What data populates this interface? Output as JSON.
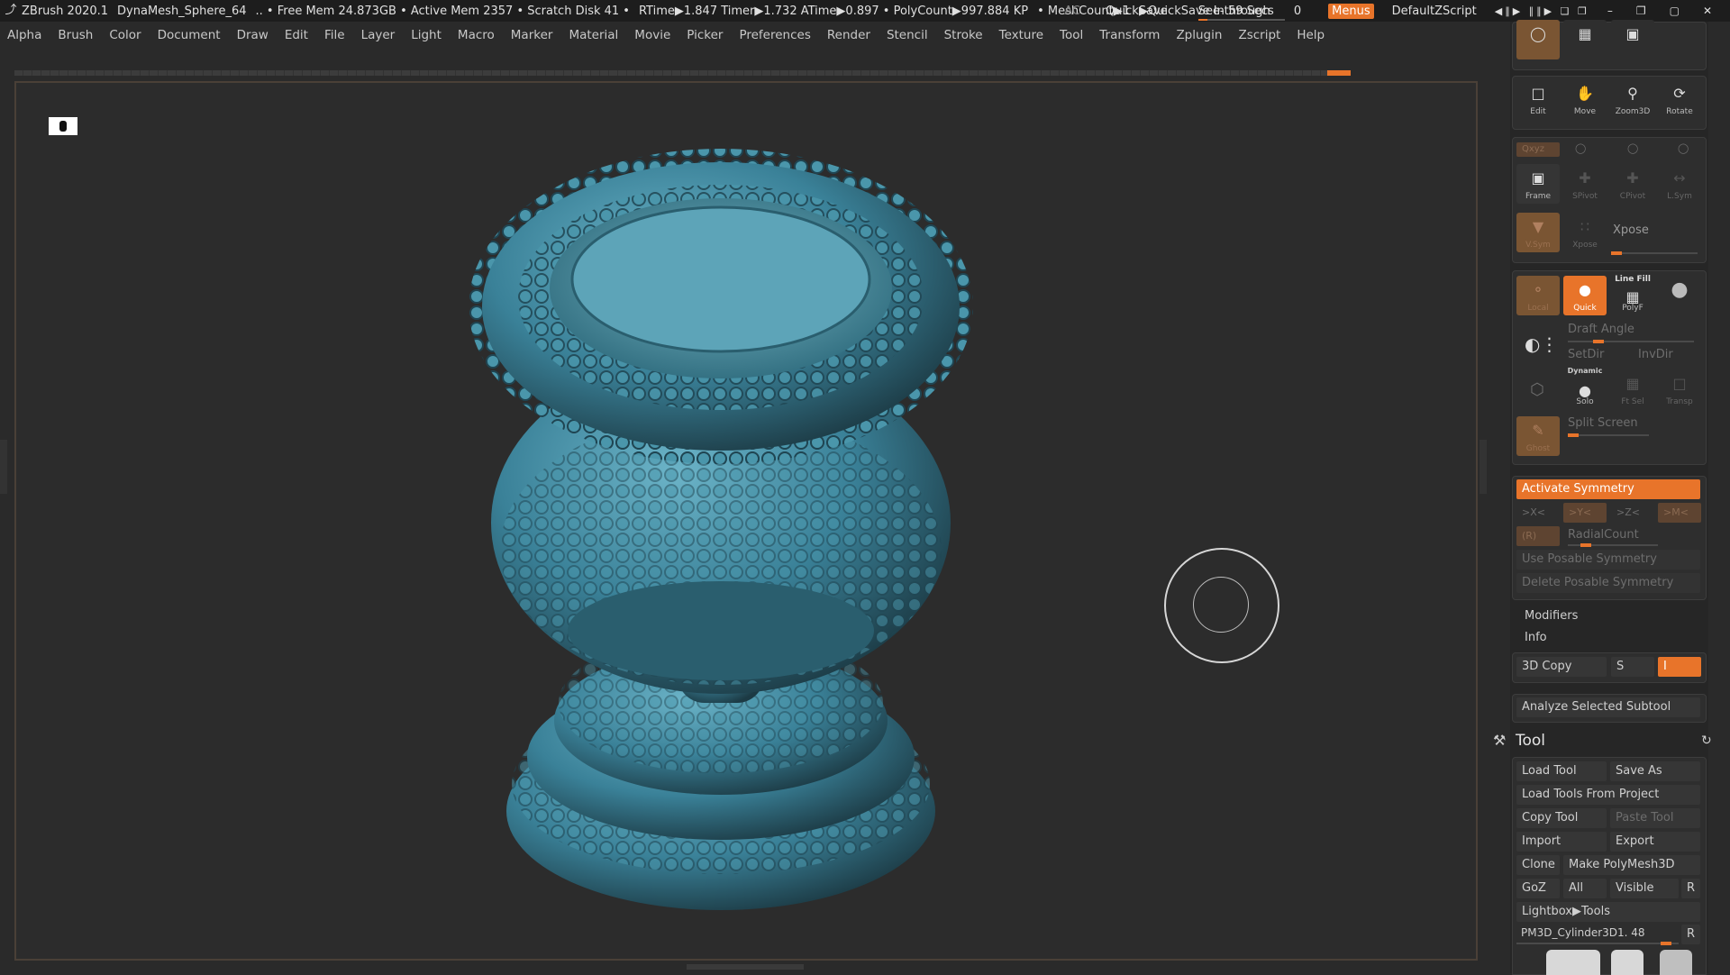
{
  "titlebar": {
    "app": "ZBrush 2020.1",
    "doc": "DynaMesh_Sphere_64",
    "stats": ".. • Free Mem 24.873GB • Active Mem 2357 • Scratch Disk 41 •",
    "times": "RTime▶1.847 Timer▶1.732 ATime▶0.897 • PolyCount▶997.884 KP",
    "meshcount": "• MeshCount▶1",
    "quicksave_in": "▶QuickSave In 59 Secs",
    "ac": "AC",
    "quicksave": "QuickSave",
    "seethrough": "See-through",
    "seethrough_value": "0",
    "menus": "Menus",
    "script": "DefaultZScript"
  },
  "menubar": [
    "Alpha",
    "Brush",
    "Color",
    "Document",
    "Draw",
    "Edit",
    "File",
    "Layer",
    "Light",
    "Macro",
    "Marker",
    "Material",
    "Movie",
    "Picker",
    "Preferences",
    "Render",
    "Stencil",
    "Stroke",
    "Texture",
    "Tool",
    "Transform",
    "Zplugin",
    "Zscript",
    "Help"
  ],
  "tray": {
    "nav": [
      "Edit",
      "Move",
      "Zoom3D",
      "Rotate"
    ],
    "xyz": "Qxyz",
    "frame_row": [
      "Frame",
      "SPivot",
      "CPivot",
      "L.Sym"
    ],
    "vsym": "V.Sym",
    "xpose_small": "Xpose",
    "xpose": "Xpose",
    "local": "Local",
    "quick": "Quick",
    "linefill": "Line Fill",
    "polyf": "PolyF",
    "draft_angle": "Draft Angle",
    "setdir": "SetDir",
    "invdir": "InvDir",
    "dynamic": "Dynamic",
    "solo": "Solo",
    "ftsel": "Ft Sel",
    "transp": "Transp",
    "ghost": "Ghost",
    "split_screen": "Split Screen",
    "activate_symmetry": "Activate Symmetry",
    "axes": [
      ">X<",
      ">Y<",
      ">Z<",
      ">M<"
    ],
    "radial_r": "(R)",
    "radialcount": "RadialCount",
    "use_posable": "Use Posable Symmetry",
    "delete_posable": "Delete Posable Symmetry",
    "modifiers": "Modifiers",
    "info": "Info",
    "copy3d": "3D Copy",
    "s_btn": "S",
    "i_btn": "I",
    "analyze": "Analyze Selected Subtool",
    "tool_title": "Tool",
    "load_tool": "Load Tool",
    "save_as": "Save As",
    "load_from_project": "Load Tools From Project",
    "copy_tool": "Copy Tool",
    "paste_tool": "Paste Tool",
    "import": "Import",
    "export": "Export",
    "clone": "Clone",
    "make_polymesh": "Make PolyMesh3D",
    "goz": "GoZ",
    "all": "All",
    "visible": "Visible",
    "r": "R",
    "lightbox_tools": "Lightbox▶Tools",
    "current_tool": "PM3D_Cylinder3D1. 48",
    "r2": "R"
  },
  "colors": {
    "accent": "#e8742a",
    "mesh": "#3f8aa0"
  }
}
